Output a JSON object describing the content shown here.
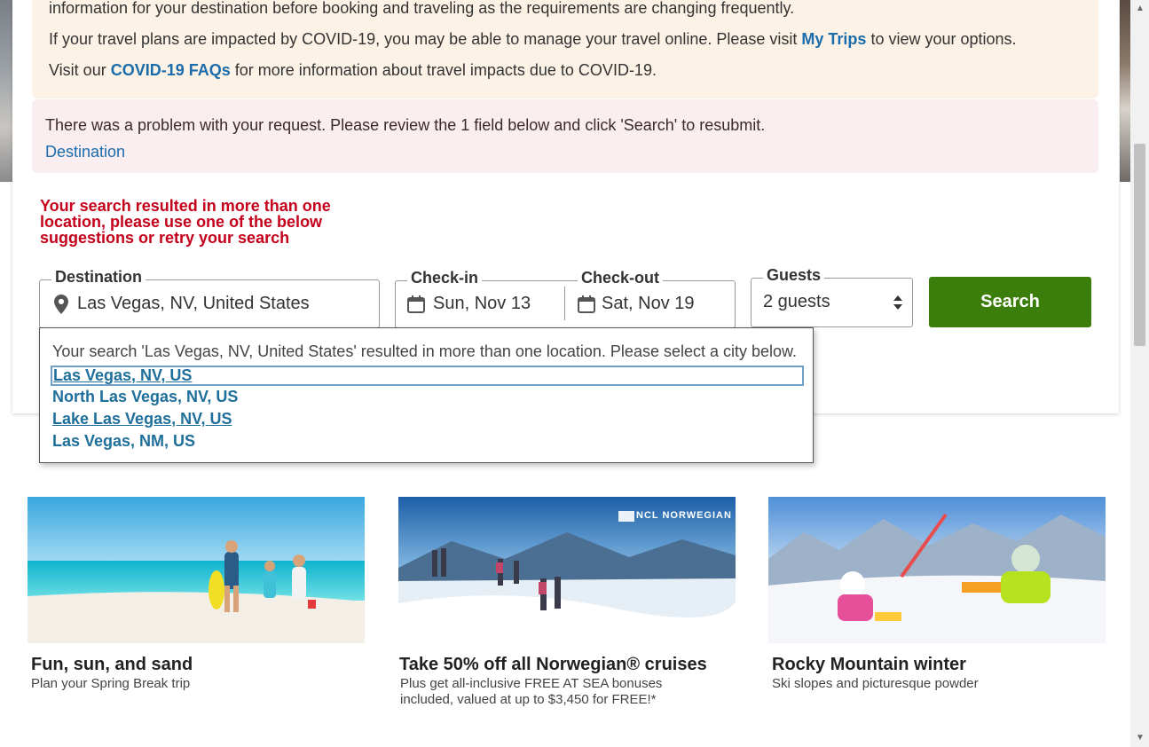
{
  "notice": {
    "line1": "information for your destination before booking and traveling as the requirements are changing frequently.",
    "line2_pre": "If your travel plans are impacted by COVID-19, you may be able to manage your travel online. Please visit ",
    "line2_link": "My Trips",
    "line2_post": " to view your options.",
    "line3_pre": "Visit our ",
    "line3_link": "COVID-19 FAQs",
    "line3_post": " for more information about travel impacts due to COVID-19."
  },
  "error": {
    "message": "There was a problem with your request. Please review the 1 field below and click 'Search' to resubmit.",
    "field_link": "Destination"
  },
  "warning": "Your search resulted in more than one location, please use one of the below suggestions or retry your search",
  "form": {
    "destination_label": "Destination",
    "destination_value": "Las Vegas, NV, United States",
    "checkin_label": "Check-in",
    "checkin_value": "Sun, Nov 13",
    "checkout_label": "Check-out",
    "checkout_value": "Sat, Nov 19",
    "guests_label": "Guests",
    "guests_value": "2 guests",
    "search_label": "Search"
  },
  "suggestions": {
    "header": "Your search 'Las Vegas, NV, United States' resulted in more than one location. Please select a city below.",
    "items": [
      "Las Vegas, NV, US",
      "North Las Vegas, NV, US",
      "Lake Las Vegas, NV, US",
      "Las Vegas, NM, US"
    ]
  },
  "promos": [
    {
      "title": "Fun, sun, and sand",
      "subtitle": "Plan your Spring Break trip"
    },
    {
      "title": "Take 50% off all Norwegian® cruises",
      "subtitle": "Plus get all-inclusive FREE AT SEA bonuses included, valued at up to $3,450 for FREE!*",
      "badge": "NCL NORWEGIAN"
    },
    {
      "title": "Rocky Mountain winter",
      "subtitle": "Ski slopes and picturesque powder"
    }
  ],
  "colors": {
    "accent": "#1a6cab",
    "search_button": "#3c7e0b",
    "error_text": "#c4001a",
    "notice_bg": "#fdf2e6",
    "error_bg": "#fbeef1"
  }
}
